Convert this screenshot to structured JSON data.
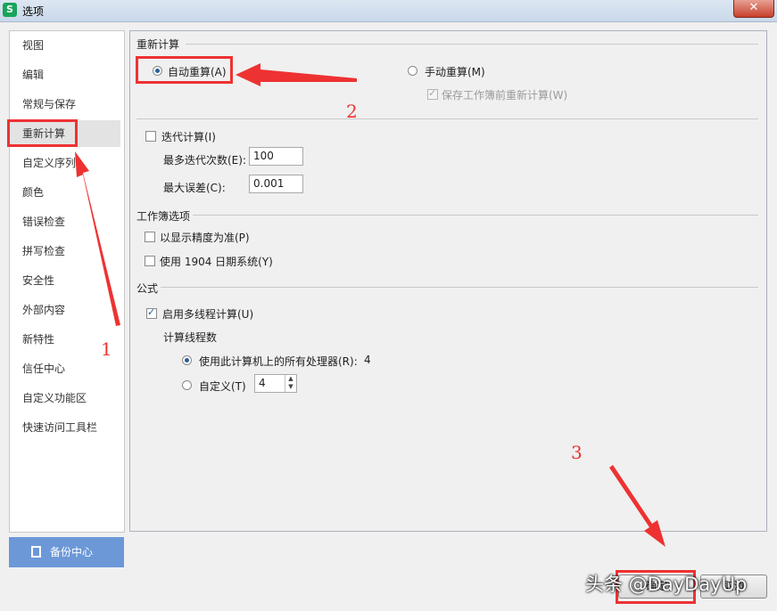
{
  "window": {
    "app_icon_letter": "S",
    "title": "选项",
    "close_symbol": "✕"
  },
  "sidebar": {
    "items": [
      {
        "label": "视图"
      },
      {
        "label": "编辑"
      },
      {
        "label": "常规与保存"
      },
      {
        "label": "重新计算"
      },
      {
        "label": "自定义序列"
      },
      {
        "label": "颜色"
      },
      {
        "label": "错误检查"
      },
      {
        "label": "拼写检查"
      },
      {
        "label": "安全性"
      },
      {
        "label": "外部内容"
      },
      {
        "label": "新特性"
      },
      {
        "label": "信任中心"
      },
      {
        "label": "自定义功能区"
      },
      {
        "label": "快速访问工具栏"
      }
    ],
    "active_index": 3,
    "backup_button": "备份中心"
  },
  "recalc": {
    "section_title": "重新计算",
    "auto_label": "自动重算(A)",
    "auto_selected": true,
    "manual_label": "手动重算(M)",
    "save_recalc_label": "保存工作簿前重新计算(W)",
    "save_recalc_checked": true
  },
  "iteration": {
    "enable_label": "迭代计算(I)",
    "enabled": false,
    "max_iter_label": "最多迭代次数(E):",
    "max_iter_value": "100",
    "max_change_label": "最大误差(C):",
    "max_change_value": "0.001"
  },
  "workbook": {
    "section_title": "工作簿选项",
    "precision_label": "以显示精度为准(P)",
    "precision_checked": false,
    "date1904_label": "使用 1904 日期系统(Y)",
    "date1904_checked": false
  },
  "formula": {
    "section_title": "公式",
    "multithread_label": "启用多线程计算(U)",
    "multithread_checked": true,
    "threads_title": "计算线程数",
    "all_processors_label": "使用此计算机上的所有处理器(R):",
    "all_processors_value": "4",
    "all_processors_selected": true,
    "custom_label": "自定义(T)",
    "custom_value": "4"
  },
  "footer": {
    "ok_label": "确定",
    "cancel_label": "取消"
  },
  "annotations": {
    "num1": "1",
    "num2": "2",
    "num3": "3",
    "color": "#ee3232"
  },
  "watermark": "头条 @DayDayUp"
}
